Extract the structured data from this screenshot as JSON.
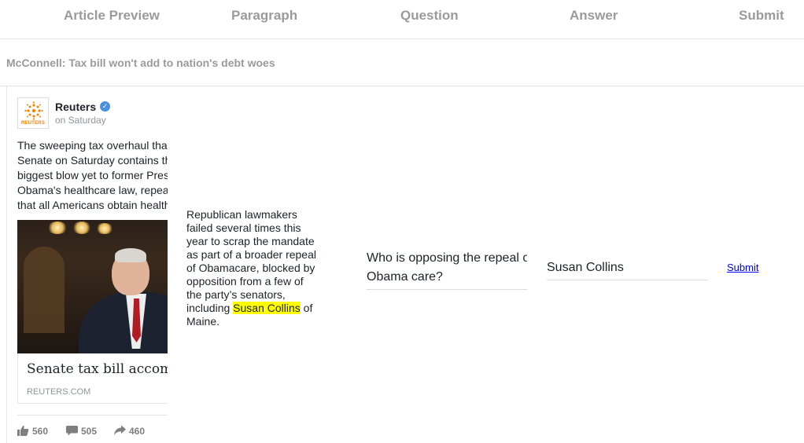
{
  "tabs": [
    {
      "label": "Article Preview"
    },
    {
      "label": "Paragraph"
    },
    {
      "label": "Question"
    },
    {
      "label": "Answer"
    },
    {
      "label": "Submit"
    }
  ],
  "headline": "McConnell: Tax bill won't add to nation's debt woes",
  "post": {
    "source": "Reuters",
    "avatar_text": "REUTERS",
    "time": "on Saturday",
    "text_lines": [
      "The sweeping tax overhaul that",
      "Senate on Saturday contains th",
      "biggest blow yet to former Pres",
      "Obama's healthcare law, repea",
      "that all Americans obtain health"
    ],
    "link_title": "Senate tax bill accompl",
    "link_domain": "REUTERS.COM",
    "likes": "560",
    "comments": "505",
    "shares": "460",
    "icons": [
      "verified-badge-icon",
      "thumbs-up-icon",
      "comment-icon",
      "share-arrow-icon"
    ]
  },
  "paragraph": {
    "lines": [
      "Republican lawmakers",
      "failed several times this",
      "year to scrap the mandate",
      "as part of a broader repeal",
      "of Obamacare, blocked by",
      "opposition from a few of",
      "the party’s senators,"
    ],
    "last_before": "including ",
    "highlight": "Susan Collins",
    "last_after": " of",
    "final": "Maine."
  },
  "question": {
    "line1": "Who is opposing the repeal of",
    "line2": "Obama care?"
  },
  "answer": {
    "value": "Susan Collins"
  },
  "submit": {
    "label": "Submit"
  },
  "colors": {
    "tab_text": "#9a9a9a",
    "highlight": "#ffff00",
    "link": "#0000ee",
    "verified": "#4a90e2",
    "reuters_orange": "#ff8000"
  }
}
